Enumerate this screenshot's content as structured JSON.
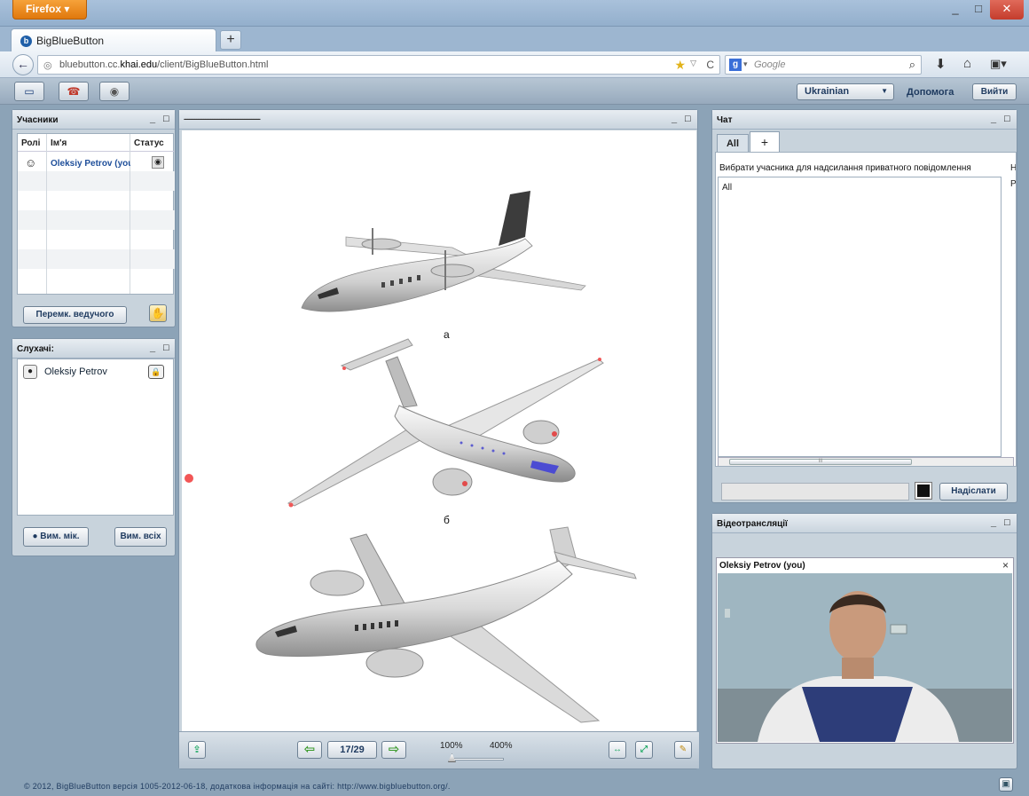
{
  "window": {
    "firefox_button": "Firefox",
    "minimize": "_",
    "maximize": "□",
    "close": "✕"
  },
  "tab": {
    "title": "BigBlueButton",
    "new_tab": "+"
  },
  "navigation": {
    "url_host_pre": "bluebutton.cc.",
    "url_host_bold": "khai.edu",
    "url_path": "/client/BigBlueButton.html",
    "search_engine_icon": "g",
    "search_placeholder": "Google"
  },
  "app_toolbar": {
    "language": "Ukrainian",
    "help": "Допомога",
    "logout": "Вийти"
  },
  "participants": {
    "title": "Учасники",
    "col_role": "Ролі",
    "col_name": "Ім'я",
    "col_status": "Статус",
    "rows": [
      {
        "name": "Oleksiy Petrov (you)"
      }
    ],
    "switch_presenter": "Перемк. ведучого"
  },
  "listeners": {
    "title": "Слухачі:",
    "rows": [
      {
        "name": "Oleksiy Petrov"
      }
    ],
    "mute_me": "Вим. мік.",
    "mute_all": "Вим. всіх"
  },
  "presentation": {
    "title": "-------------------------------------------",
    "caption_a": "а",
    "caption_b": "б",
    "page_counter": "17/29",
    "zoom_min": "100%",
    "zoom_max": "400%"
  },
  "chat": {
    "title": "Чат",
    "tab_all": "All",
    "tab_add": "+",
    "select_hint": "Вибрати учасника для надсилання приватного повідомлення",
    "side_h": "Н",
    "side_p": "Р",
    "list_item": "All",
    "scroll_grip": "III",
    "send": "Надіслати"
  },
  "video": {
    "title": "Відеотрансляції",
    "owner": "Oleksiy Petrov (you)",
    "close": "×"
  },
  "footer": "© 2012, BigBlueButton версія 1005-2012-06-18, додаткова інформація на сайті: http://www.bigbluebutton.org/."
}
